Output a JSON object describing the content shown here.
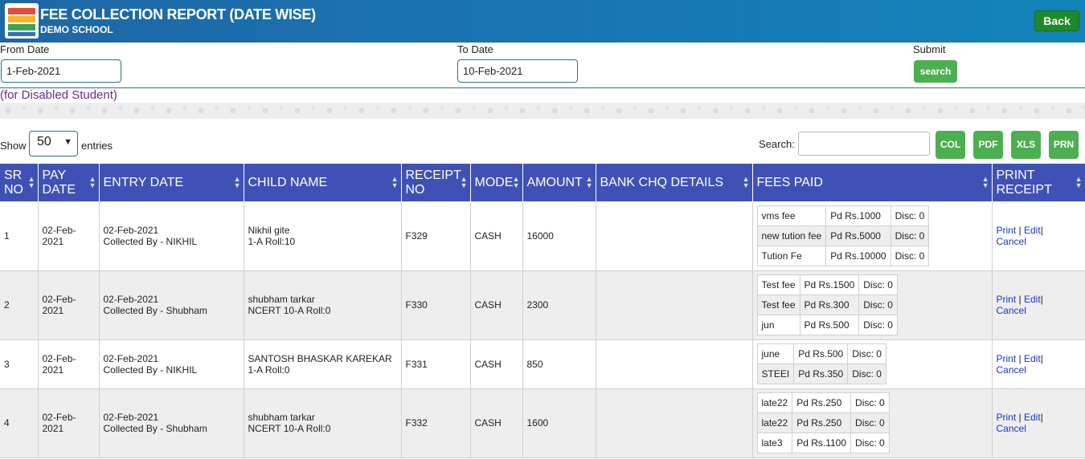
{
  "header": {
    "title": "FEE COLLECTION REPORT (DATE WISE)",
    "school": "DEMO SCHOOL",
    "back_label": "Back"
  },
  "filters": {
    "from_label": "From Date",
    "from_value": "1-Feb-2021",
    "to_label": "To Date",
    "to_value": "10-Feb-2021",
    "submit_label": "Submit",
    "search_button": "search"
  },
  "note": "(for Disabled Student)",
  "table_controls": {
    "show_label": "Show",
    "entries_value": "50",
    "entries_label": "entries",
    "search_label": "Search:",
    "buttons": [
      "COL",
      "PDF",
      "XLS",
      "PRN"
    ]
  },
  "columns": [
    {
      "line1": "SR",
      "line2": "NO"
    },
    {
      "line1": "PAY",
      "line2": "DATE"
    },
    {
      "line1": "ENTRY DATE",
      "line2": ""
    },
    {
      "line1": "CHILD NAME",
      "line2": ""
    },
    {
      "line1": "RECEIPT",
      "line2": "NO"
    },
    {
      "line1": "MODE",
      "line2": ""
    },
    {
      "line1": "AMOUNT",
      "line2": ""
    },
    {
      "line1": "BANK CHQ DETAILS",
      "line2": ""
    },
    {
      "line1": "FEES PAID",
      "line2": ""
    },
    {
      "line1": "PRINT",
      "line2": "RECEIPT"
    }
  ],
  "rows": [
    {
      "sr": "1",
      "pay_date_1": "02-Feb-",
      "pay_date_2": "2021",
      "entry_date": "02-Feb-2021",
      "collected_by": "Collected By - NIKHIL",
      "child_name": "Nikhil gite",
      "child_class": "1-A Roll:10",
      "receipt": "F329",
      "mode": "CASH",
      "amount": "16000",
      "bank": "",
      "fees": [
        {
          "name": "vms fee",
          "paid": "Pd Rs.1000",
          "disc": "Disc: 0"
        },
        {
          "name": "new tution fee",
          "paid": "Pd Rs.5000",
          "disc": "Disc: 0"
        },
        {
          "name": "Tution Fe",
          "paid": "Pd Rs.10000",
          "disc": "Disc: 0"
        }
      ],
      "actions": {
        "print": "Print",
        "sep1": "|",
        "edit": "Edit",
        "sep2": "|",
        "cancel": "Cancel"
      }
    },
    {
      "sr": "2",
      "pay_date_1": "02-Feb-",
      "pay_date_2": "2021",
      "entry_date": "02-Feb-2021",
      "collected_by": "Collected By - Shubham",
      "child_name": "shubham tarkar",
      "child_class": "NCERT 10-A Roll:0",
      "receipt": "F330",
      "mode": "CASH",
      "amount": "2300",
      "bank": "",
      "fees": [
        {
          "name": "Test fee",
          "paid": "Pd Rs.1500",
          "disc": "Disc: 0"
        },
        {
          "name": "Test fee",
          "paid": "Pd Rs.300",
          "disc": "Disc: 0"
        },
        {
          "name": "jun",
          "paid": "Pd Rs.500",
          "disc": "Disc: 0"
        }
      ],
      "actions": {
        "print": "Print",
        "sep1": "|",
        "edit": "Edit",
        "sep2": "|",
        "cancel": "Cancel"
      }
    },
    {
      "sr": "3",
      "pay_date_1": "02-Feb-",
      "pay_date_2": "2021",
      "entry_date": "02-Feb-2021",
      "collected_by": "Collected By - NIKHIL",
      "child_name": "SANTOSH BHASKAR KAREKAR",
      "child_class": "1-A Roll:0",
      "receipt": "F331",
      "mode": "CASH",
      "amount": "850",
      "bank": "",
      "fees": [
        {
          "name": "june",
          "paid": "Pd Rs.500",
          "disc": "Disc: 0"
        },
        {
          "name": "STEEI",
          "paid": "Pd Rs.350",
          "disc": "Disc: 0"
        }
      ],
      "actions": {
        "print": "Print",
        "sep1": "|",
        "edit": "Edit",
        "sep2": "|",
        "cancel": "Cancel"
      }
    },
    {
      "sr": "4",
      "pay_date_1": "02-Feb-",
      "pay_date_2": "2021",
      "entry_date": "02-Feb-2021",
      "collected_by": "Collected By - Shubham",
      "child_name": "shubham tarkar",
      "child_class": "NCERT 10-A Roll:0",
      "receipt": "F332",
      "mode": "CASH",
      "amount": "1600",
      "bank": "",
      "fees": [
        {
          "name": "late22",
          "paid": "Pd Rs.250",
          "disc": "Disc: 0"
        },
        {
          "name": "late22",
          "paid": "Pd Rs.250",
          "disc": "Disc: 0"
        },
        {
          "name": "late3",
          "paid": "Pd Rs.1100",
          "disc": "Disc: 0"
        }
      ],
      "actions": {
        "print": "Print",
        "sep1": "|",
        "edit": "Edit",
        "sep2": "|",
        "cancel": "Cancel"
      }
    }
  ],
  "colors": {
    "header_bg": "#1a74b0",
    "table_header_bg": "#3f51b5",
    "button_green": "#4caf50",
    "back_green": "#1f8a2c",
    "link_blue": "#1a35c8",
    "note_purple": "#6a2b8c"
  }
}
